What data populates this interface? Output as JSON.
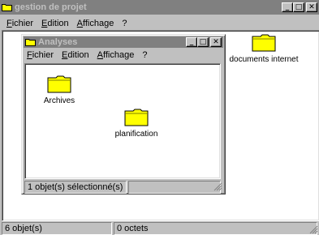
{
  "outer": {
    "title": "gestion de projet",
    "menu": [
      "Fichier",
      "Edition",
      "Affichage",
      "?"
    ],
    "status": [
      "6 objet(s)",
      "0 octets"
    ]
  },
  "inner": {
    "title": "Analyses",
    "menu": [
      "Fichier",
      "Edition",
      "Affichage",
      "?"
    ],
    "status": [
      "1 objet(s) sélectionné(s)",
      ""
    ],
    "folders": [
      "Archives",
      "planification"
    ]
  },
  "desktop_folders": [
    "documents internet"
  ],
  "title_buttons": {
    "minimize": "_",
    "maximize": "□",
    "close": "✕"
  },
  "colors": {
    "inactive_title": "#808080",
    "folder_yellow": "#ffff00",
    "face": "#c0c0c0"
  }
}
